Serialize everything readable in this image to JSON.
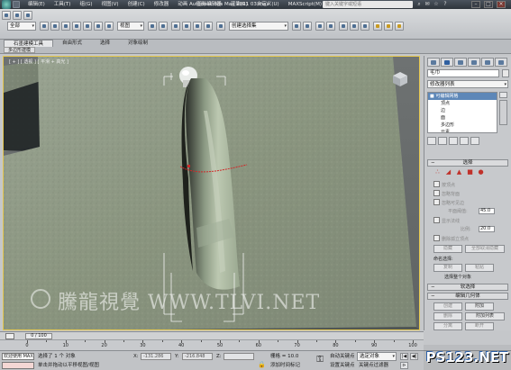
{
  "titlebar": {
    "menus": [
      "编辑(E)",
      "工具(T)",
      "组(G)",
      "视图(V)",
      "创建(C)",
      "修改器",
      "动画",
      "图形编辑器",
      "渲染(R)",
      "自定义(U)",
      "MAXScript(M)",
      "帮助(H)"
    ],
    "title": "Autodesk 3ds Max  2011      03.max",
    "search_placeholder": "键入关键字或短语"
  },
  "toolbar": {
    "selection_filter": "全部",
    "ref_coord": "视图",
    "named_sel": "创建选择集"
  },
  "ribbon": {
    "tabs": [
      "石墨建模工具",
      "自由形式",
      "选择",
      "对象绘制"
    ],
    "active_tab": 0,
    "sub_label": "多边形建模"
  },
  "viewport": {
    "label": "[ + ] [ 透视 ] [ 平滑 + 高光 ]",
    "watermark": "騰龍視覺 WWW.TLVI.NET"
  },
  "command_panel": {
    "object_name": "毛巾",
    "modifier_list": "修改器列表",
    "stack": [
      {
        "label": "■ 可编辑网格",
        "level": 0,
        "selected": true
      },
      {
        "label": "顶点",
        "level": 1,
        "selected": false
      },
      {
        "label": "边",
        "level": 1,
        "selected": false
      },
      {
        "label": "面",
        "level": 1,
        "selected": false
      },
      {
        "label": "多边形",
        "level": 1,
        "selected": false
      },
      {
        "label": "元素",
        "level": 1,
        "selected": false
      }
    ],
    "selection_rollout": "选择",
    "checkboxes": [
      "按顶点",
      "忽略背面",
      "忽略可见边"
    ],
    "planar_label": "平面阈值:",
    "planar_value": "45.0",
    "show_normals": "显示法线",
    "scale_label": "比例:",
    "scale_value": "20.0",
    "delete_isolated": "删除孤立顶点",
    "hide_btn": "隐藏",
    "unhide_btn": "全部取消隐藏",
    "named_sel_label": "命名选择:",
    "copy_btn": "复制",
    "paste_btn": "粘贴",
    "selected_status": "选择整个对象",
    "soft_sel_rollout": "软选择",
    "edit_geo_rollout": "编辑几何体",
    "create_btn": "创建",
    "delete_btn": "删除",
    "attach_btn": "附加",
    "attach_list_btn": "附加列表",
    "detach_btn": "分离",
    "break_btn": "断开",
    "turn_btn": "改向"
  },
  "timeline": {
    "slider": "0 / 100",
    "ticks": [
      0,
      10,
      20,
      30,
      40,
      50,
      60,
      70,
      80,
      90,
      100
    ]
  },
  "statusbar": {
    "maxscript": "欢迎使用 MAXSc",
    "selected_count": "选择了 1 个 对象",
    "prompt": "单击并拖动以平移视图/视图",
    "x_label": "X:",
    "x_value": "-131.286",
    "y_label": "Y:",
    "y_value": "-216.848",
    "z_label": "Z:",
    "grid": "栅格 = 10.0",
    "add_time_tag": "添加时间标记",
    "auto_key": "自动关键点",
    "set_key": "设置关键点",
    "selected_object": "选定对象",
    "key_filters": "关键点过滤器"
  },
  "watermark_logo": "PS123.NET",
  "colors": {
    "accent": "#5d87b8",
    "viewport_border": "#e6c84f",
    "wall": "#8f9a86",
    "towel": "#a9b7a0"
  }
}
